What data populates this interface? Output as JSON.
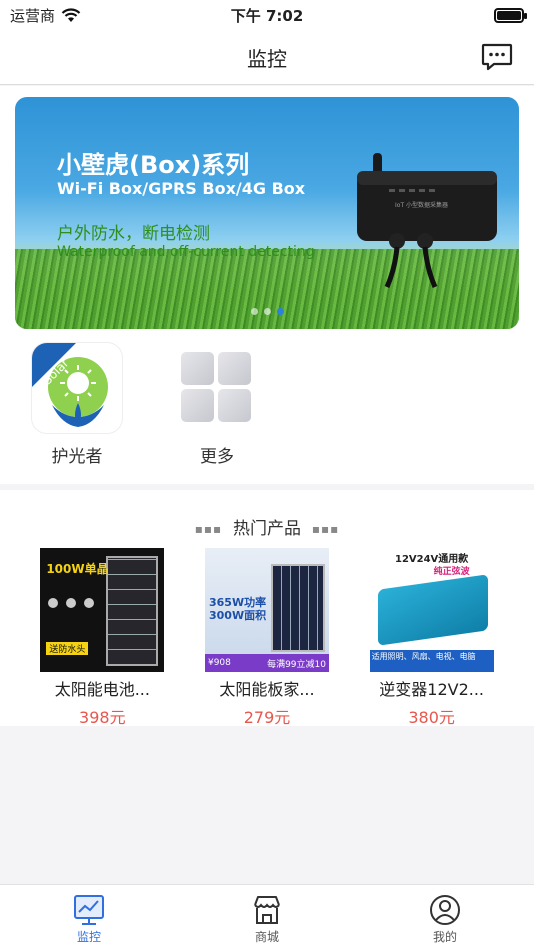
{
  "status_bar": {
    "carrier": "运营商",
    "time": "下午 7:02"
  },
  "nav": {
    "title": "监控",
    "message_icon": "message-icon"
  },
  "banner": {
    "title": "小壁虎(Box)系列",
    "subtitle": "Wi-Fi Box/GPRS Box/4G Box",
    "tagline": "户外防水，断电检测",
    "tagline_en": "Waterproof and off-current detecting",
    "device_label": "IoT 小型数据采集器",
    "page_count": 3,
    "active_page": 3
  },
  "apps": [
    {
      "label": "护光者",
      "badge": "Solar",
      "icon": "solar-guardian-logo"
    },
    {
      "label": "更多",
      "icon": "more-grid-icon"
    }
  ],
  "hot_products": {
    "title": "热门产品",
    "items": [
      {
        "name": "太阳能电池...",
        "price": "398元",
        "img_text_top": "100W单晶",
        "img_text_badge": "送防水头"
      },
      {
        "name": "太阳能板家...",
        "price": "279元",
        "img_text_top": "365W功率",
        "img_text_mid": "300W面积",
        "img_text_promo": "每满99立减10",
        "img_text_price": "¥908"
      },
      {
        "name": "逆变器12V2...",
        "price": "380元",
        "img_text_top": "12V24V通用款",
        "img_text_mid": "纯正弦波",
        "img_text_bottom": "适用照明、风扇、电视、电脑"
      }
    ]
  },
  "tab_bar": {
    "tabs": [
      {
        "label": "监控",
        "icon": "monitor-icon",
        "active": true
      },
      {
        "label": "商城",
        "icon": "store-icon",
        "active": false
      },
      {
        "label": "我的",
        "icon": "profile-icon",
        "active": false
      }
    ]
  },
  "colors": {
    "accent": "#2f6fe0",
    "price": "#e8574e"
  }
}
